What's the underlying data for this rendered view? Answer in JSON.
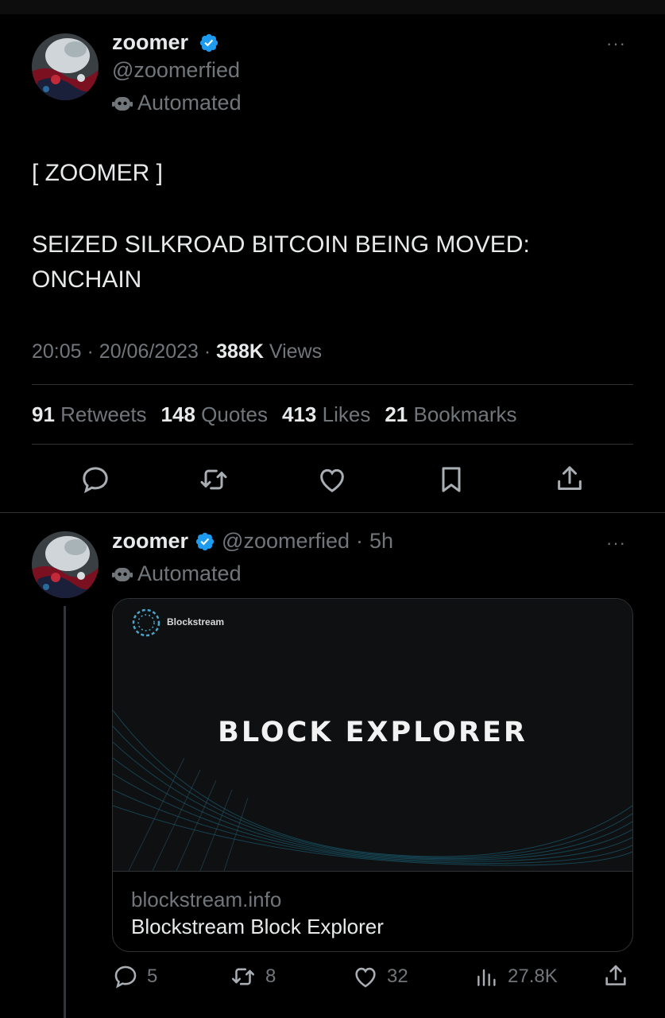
{
  "main_tweet": {
    "author": {
      "name": "zoomer",
      "handle": "@zoomerfied",
      "label": "Automated"
    },
    "more": "···",
    "text_lines": [
      "[ ZOOMER ]",
      "SEIZED SILKROAD BITCOIN BEING MOVED:",
      "ONCHAIN"
    ],
    "time": "20:05",
    "date": "20/06/2023",
    "views_count": "388K",
    "views_label": "Views",
    "stats": {
      "retweets": {
        "count": "91",
        "label": "Retweets"
      },
      "quotes": {
        "count": "148",
        "label": "Quotes"
      },
      "likes": {
        "count": "413",
        "label": "Likes"
      },
      "bookmarks": {
        "count": "21",
        "label": "Bookmarks"
      }
    }
  },
  "reply_tweet": {
    "author": {
      "name": "zoomer",
      "handle": "@zoomerfied",
      "age": "5h",
      "label": "Automated"
    },
    "more": "···",
    "card": {
      "brand": "Blockstream",
      "headline": "BLOCK EXPLORER",
      "domain": "blockstream.info",
      "title": "Blockstream Block Explorer"
    },
    "actions": {
      "replies": "5",
      "retweets": "8",
      "likes": "32",
      "views": "27.8K"
    }
  },
  "colors": {
    "background": "#000000",
    "text": "#e7e9ea",
    "muted": "#71767b",
    "verified": "#1d9bf0",
    "divider": "#2f3336"
  },
  "icons": [
    "verified-badge-icon",
    "robot-icon",
    "reply-icon",
    "retweet-icon",
    "like-icon",
    "bookmark-icon",
    "share-icon",
    "views-icon"
  ]
}
